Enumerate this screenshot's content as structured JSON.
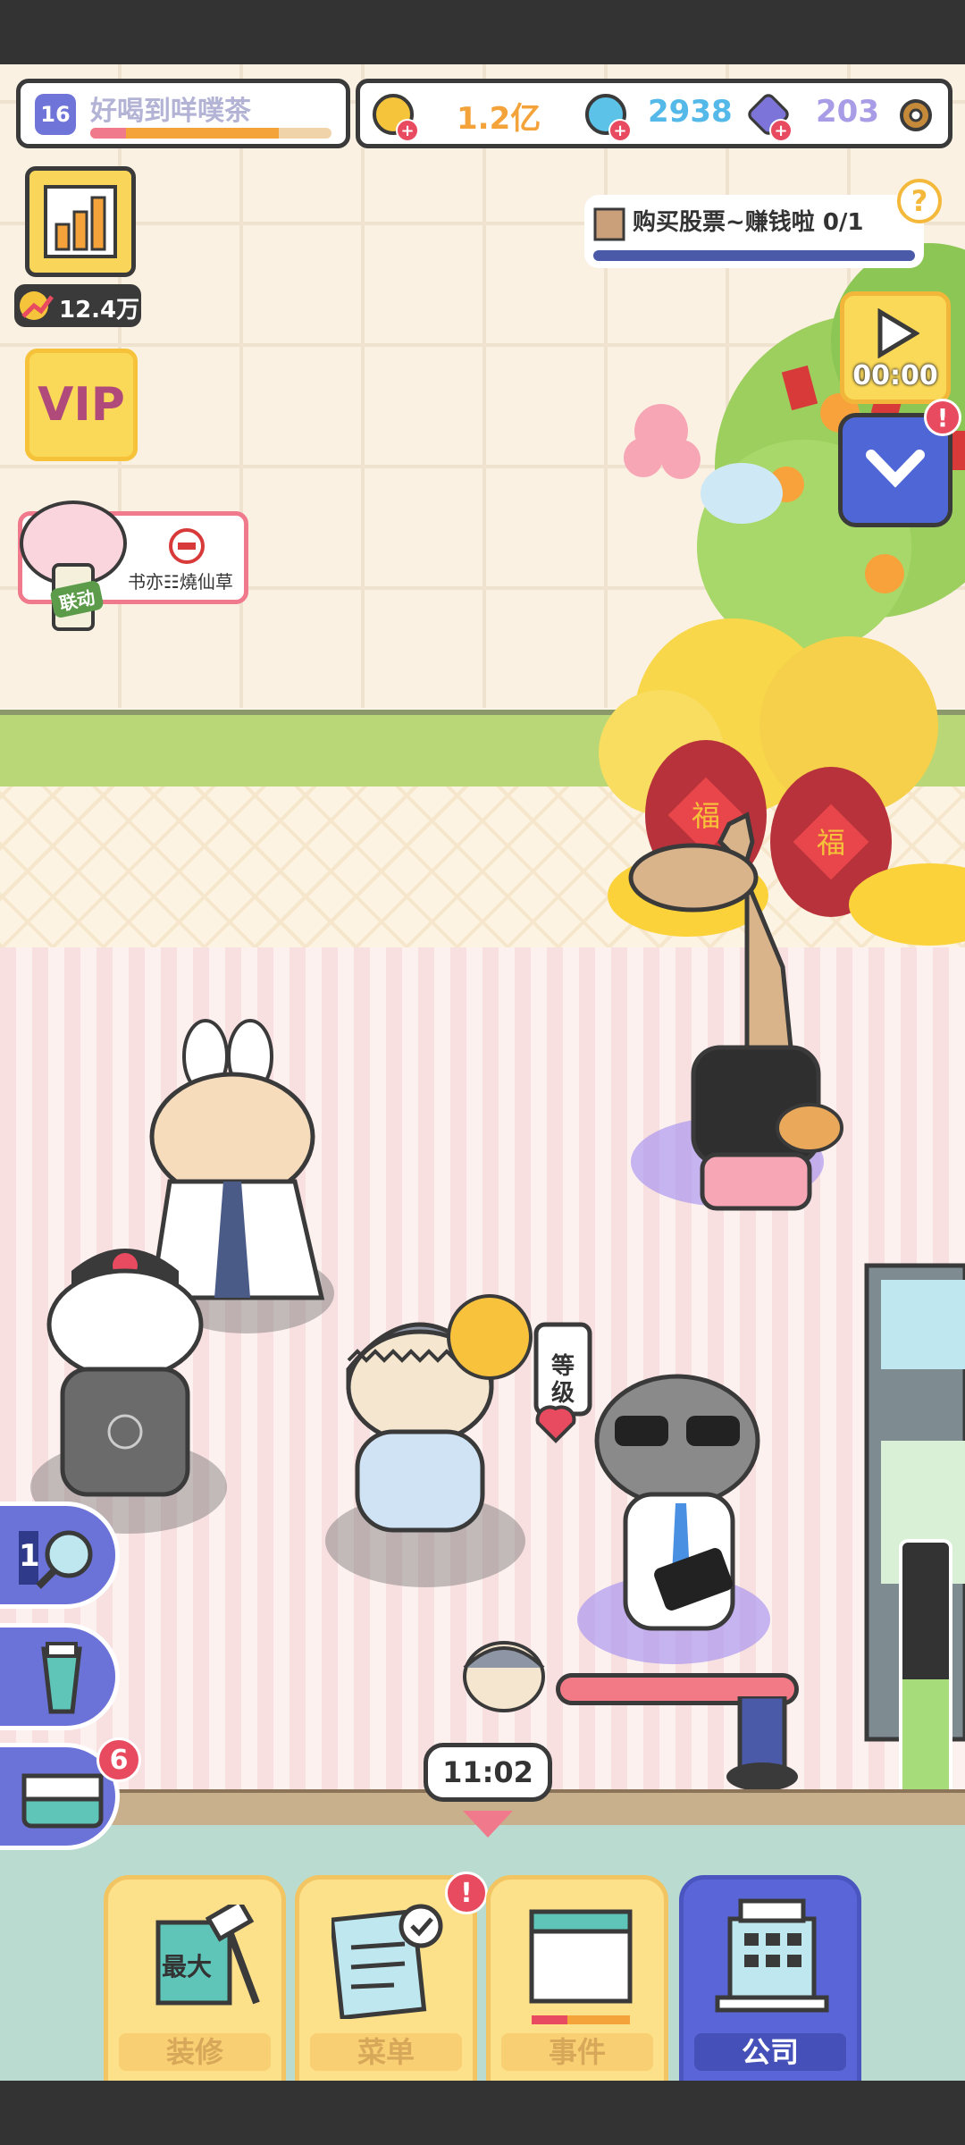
{
  "header": {
    "level": "16",
    "shop_name": "好喝到咩噗茶",
    "level_progress": 0.78
  },
  "currency": {
    "coins": "1.2亿",
    "gems": "2938",
    "crystals": "203",
    "coin_color": "#f4a23a",
    "gem_color": "#54b9e8",
    "crystal_color": "#a89ce6"
  },
  "left_panel": {
    "income": "12.4万",
    "vip_label": "VIP",
    "collab_text": "书亦☷燒仙草",
    "collab_tag": "联动"
  },
  "task": {
    "text": "购买股票~赚钱啦 0/1",
    "help": "?"
  },
  "right_panel": {
    "video_timer": "00:00",
    "alert": "!"
  },
  "scene": {
    "time": "11:02",
    "level_cup_text": "等级",
    "notification_count": "6",
    "tool_search_count": "1",
    "gauge_level": 0.48,
    "jar_text": "福"
  },
  "tabs": [
    {
      "label": "装修",
      "badge": "最大"
    },
    {
      "label": "菜单",
      "alert": "!"
    },
    {
      "label": "事件"
    },
    {
      "label": "公司"
    }
  ]
}
